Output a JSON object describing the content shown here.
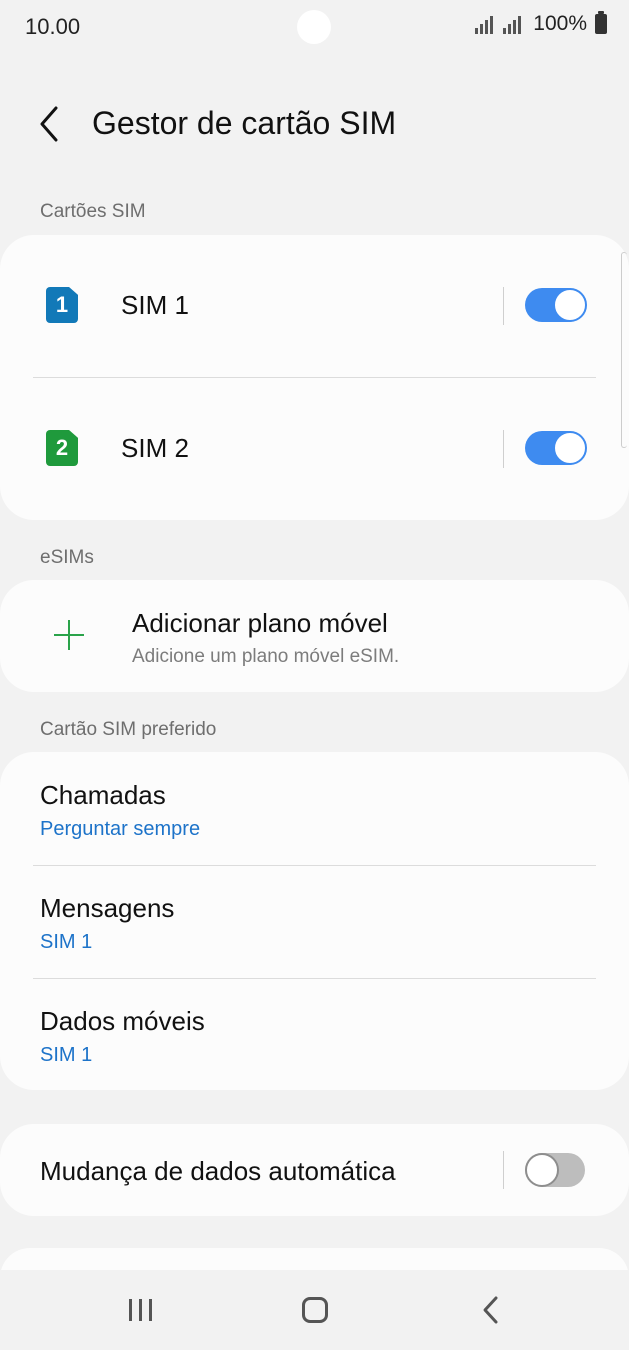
{
  "status_bar": {
    "time": "10.00",
    "battery": "100%"
  },
  "header": {
    "title": "Gestor de cartão SIM"
  },
  "sections": {
    "sim_cards": "Cartões SIM",
    "esims": "eSIMs",
    "preferred": "Cartão SIM preferido"
  },
  "sims": [
    {
      "badge": "1",
      "label": "SIM 1",
      "color": "#1279b8",
      "enabled": true
    },
    {
      "badge": "2",
      "label": "SIM 2",
      "color": "#1f9a3c",
      "enabled": true
    }
  ],
  "esim": {
    "title": "Adicionar plano móvel",
    "subtitle": "Adicione um plano móvel eSIM."
  },
  "preferred": {
    "calls": {
      "title": "Chamadas",
      "value": "Perguntar sempre"
    },
    "messages": {
      "title": "Mensagens",
      "value": "SIM 1"
    },
    "mobile_data": {
      "title": "Dados móveis",
      "value": "SIM 1"
    }
  },
  "auto_switch": {
    "title": "Mudança de dados automática",
    "enabled": false
  },
  "colors": {
    "accent": "#3e8bf0",
    "link": "#1d73c9",
    "plus": "#2aa34a"
  }
}
